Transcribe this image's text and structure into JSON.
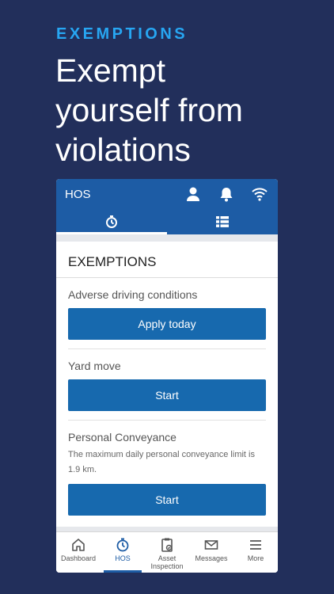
{
  "promo": {
    "eyebrow": "EXEMPTIONS",
    "headline": "Exempt\nyourself from\nviolations"
  },
  "appbar": {
    "title": "HOS",
    "icons": [
      "user-icon",
      "bell-icon",
      "wifi-icon"
    ]
  },
  "tabs": [
    {
      "icon": "stopwatch-icon",
      "active": true
    },
    {
      "icon": "list-icon",
      "active": false
    }
  ],
  "card": {
    "title": "EXEMPTIONS",
    "sections": [
      {
        "label": "Adverse driving conditions",
        "description": "",
        "button": "Apply today"
      },
      {
        "label": "Yard move",
        "description": "",
        "button": "Start"
      },
      {
        "label": "Personal Conveyance",
        "description": "The maximum daily personal conveyance limit is 1.9 km.",
        "button": "Start"
      }
    ]
  },
  "bottomnav": {
    "items": [
      {
        "label": "Dashboard",
        "icon": "home-icon"
      },
      {
        "label": "HOS",
        "icon": "stopwatch-icon",
        "active": true
      },
      {
        "label": "Asset Inspection",
        "icon": "clipboard-check-icon"
      },
      {
        "label": "Messages",
        "icon": "envelope-icon"
      },
      {
        "label": "More",
        "icon": "menu-icon"
      }
    ]
  },
  "colors": {
    "background": "#222f5b",
    "accent": "#27a6f2",
    "appbar": "#1d5ca5",
    "button": "#1769ae"
  }
}
